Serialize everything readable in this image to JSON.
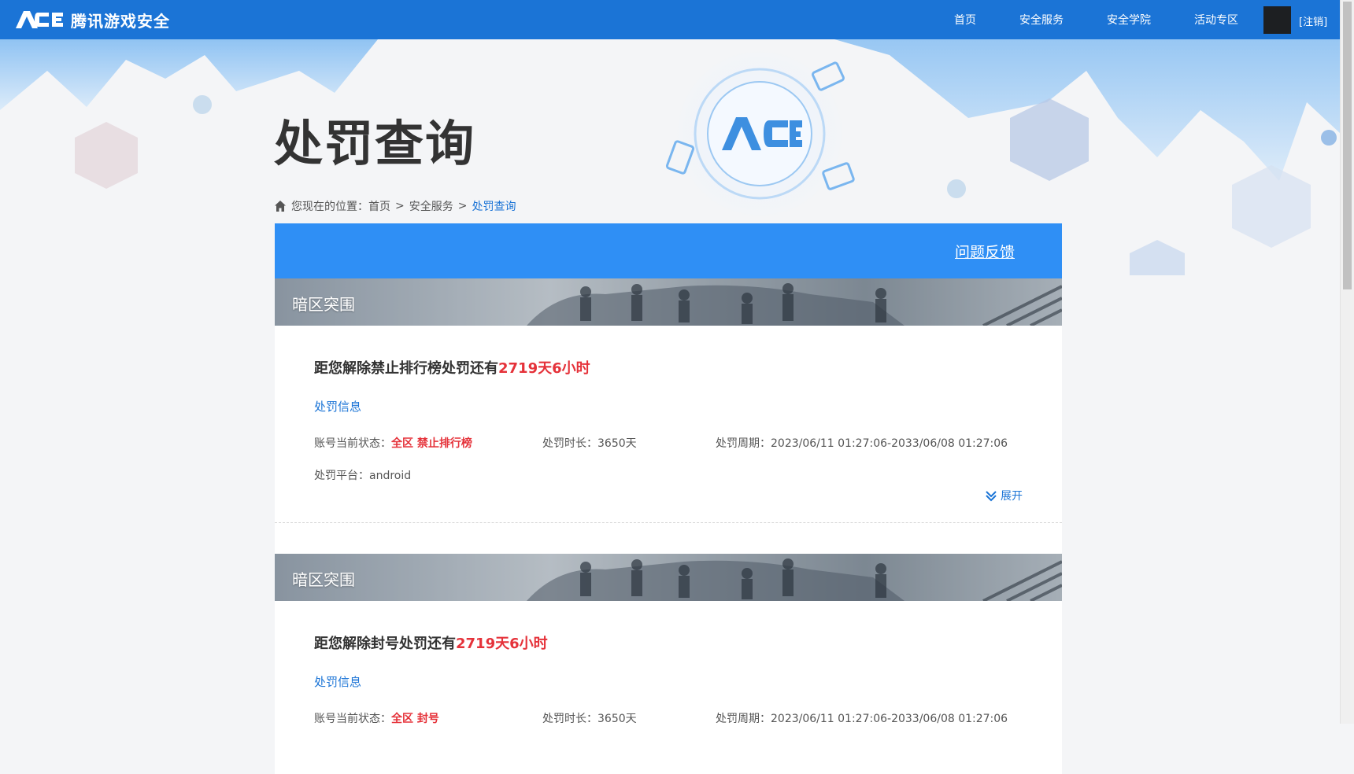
{
  "header": {
    "logo_text": "腾讯游戏安全",
    "nav": [
      "首页",
      "安全服务",
      "安全学院",
      "活动专区"
    ],
    "logout": "[注销]"
  },
  "page": {
    "title": "处罚查询",
    "breadcrumb": {
      "prefix": "您现在的位置：",
      "items": [
        "首页",
        "安全服务"
      ],
      "current": "处罚查询"
    },
    "feedback": "问题反馈"
  },
  "penalties": [
    {
      "game": "暗区突围",
      "headline_prefix": "距您解除禁止排行榜处罚还有",
      "remaining": "2719天6小时",
      "info_title": "处罚信息",
      "status_label": "账号当前状态：",
      "status_value": "全区 禁止排行榜",
      "duration_label": "处罚时长：",
      "duration_value": "3650天",
      "period_label": "处罚周期：",
      "period_value": "2023/06/11 01:27:06-2033/06/08 01:27:06",
      "platform_label": "处罚平台：",
      "platform_value": "android",
      "expand": "展开"
    },
    {
      "game": "暗区突围",
      "headline_prefix": "距您解除封号处罚还有",
      "remaining": "2719天6小时",
      "info_title": "处罚信息",
      "status_label": "账号当前状态：",
      "status_value": "全区 封号",
      "duration_label": "处罚时长：",
      "duration_value": "3650天",
      "period_label": "处罚周期：",
      "period_value": "2023/06/11 01:27:06-2033/06/08 01:27:06"
    }
  ],
  "colors": {
    "nav_bg": "#1b74d6",
    "card_head": "#2f8ff5",
    "accent_red": "#e5323a",
    "link_blue": "#1b74d6"
  }
}
